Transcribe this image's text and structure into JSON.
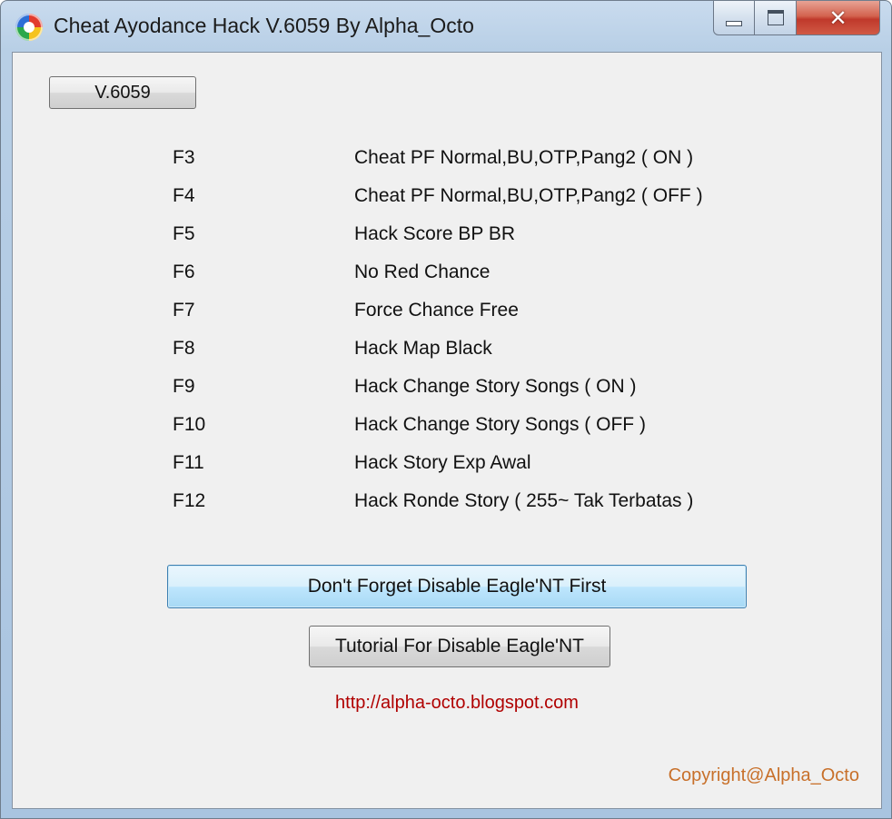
{
  "window": {
    "title": "Cheat Ayodance Hack V.6059 By Alpha_Octo",
    "caption": {
      "minimize_glyph": "",
      "maximize_glyph": "",
      "close_glyph": "✕"
    }
  },
  "version_button": {
    "label": "V.6059"
  },
  "hotkeys": [
    {
      "key": "F3",
      "description": "Cheat PF Normal,BU,OTP,Pang2 ( ON )"
    },
    {
      "key": "F4",
      "description": "Cheat PF Normal,BU,OTP,Pang2 ( OFF )"
    },
    {
      "key": "F5",
      "description": "Hack Score BP BR"
    },
    {
      "key": "F6",
      "description": "No Red Chance"
    },
    {
      "key": "F7",
      "description": "Force Chance Free"
    },
    {
      "key": "F8",
      "description": "Hack Map Black"
    },
    {
      "key": "F9",
      "description": "Hack Change Story Songs ( ON )"
    },
    {
      "key": "F10",
      "description": "Hack Change Story Songs ( OFF )"
    },
    {
      "key": "F11",
      "description": "Hack Story Exp Awal"
    },
    {
      "key": "F12",
      "description": "Hack Ronde Story ( 255~  Tak Terbatas )"
    }
  ],
  "reminder_button": {
    "label": "Don't Forget Disable Eagle'NT First"
  },
  "tutorial_button": {
    "label": "Tutorial For Disable Eagle'NT"
  },
  "blog_link": {
    "text": "http://alpha-octo.blogspot.com"
  },
  "copyright": {
    "text": "Copyright@Alpha_Octo"
  },
  "colors": {
    "link": "#b00000",
    "copyright": "#c8702a",
    "close_button": "#c0392b",
    "client_background": "#f0f0f0"
  }
}
